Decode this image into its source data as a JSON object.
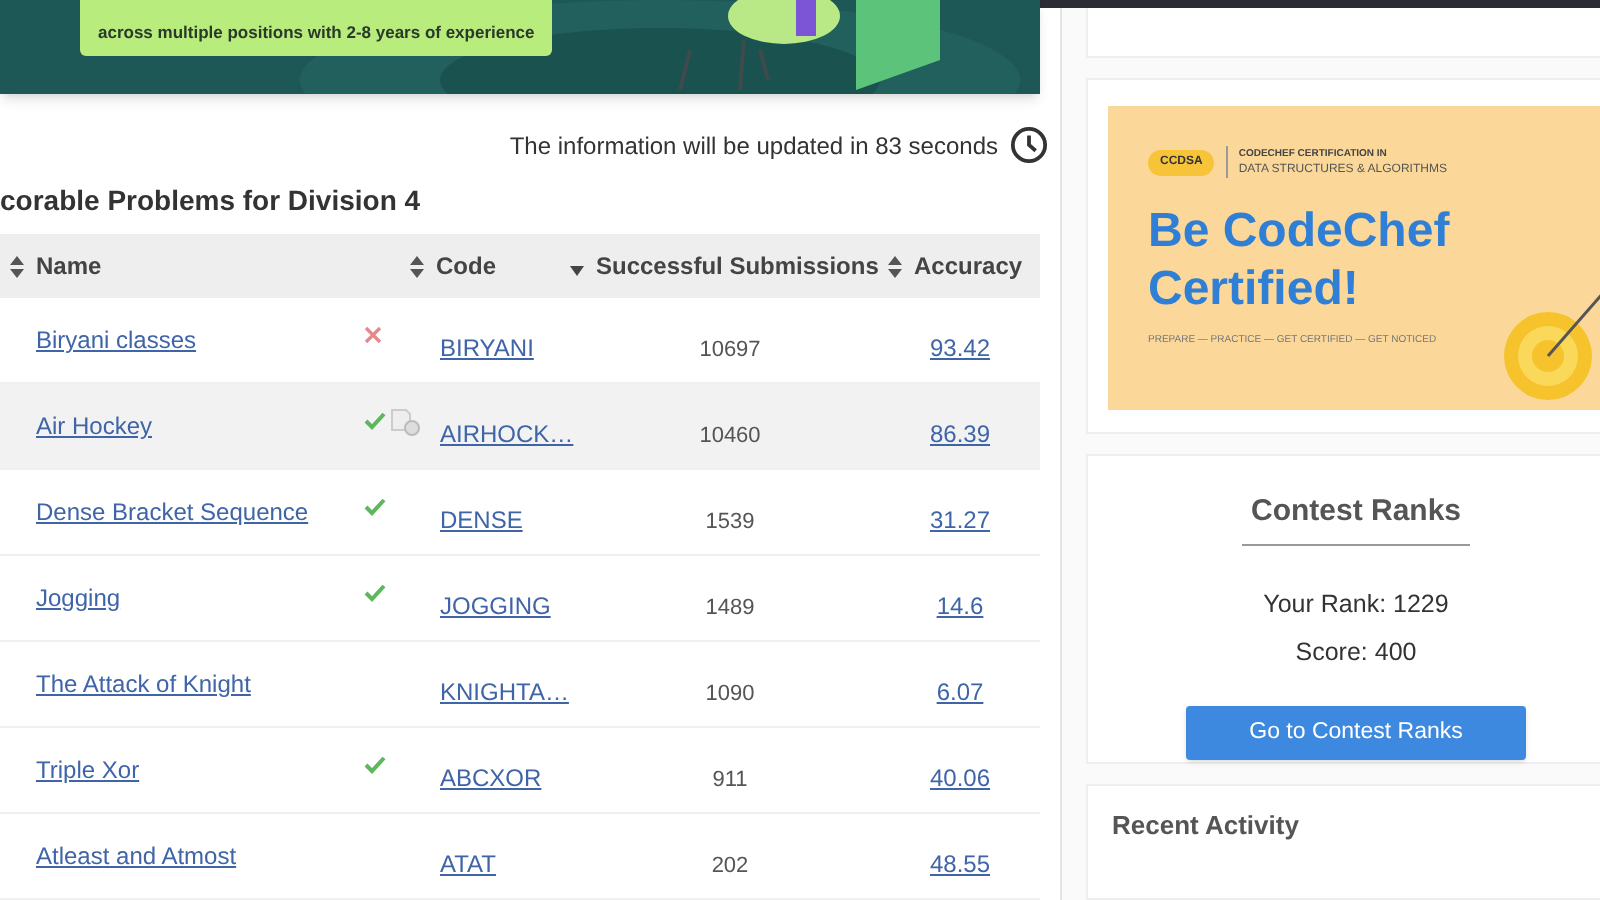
{
  "promo_banner": {
    "text": "across multiple positions with 2-8 years of experience"
  },
  "update_notice": "The information will be updated in 83 seconds",
  "problems": {
    "title": "corable Problems for Division 4",
    "columns": [
      {
        "label": "Name",
        "sorted_descending": false
      },
      {
        "label": "Code",
        "sorted_descending": false
      },
      {
        "label": "Successful Submissions",
        "sorted_descending": true
      },
      {
        "label": "Accuracy",
        "sorted_descending": false
      }
    ],
    "rows": [
      {
        "name": "Biryani classes",
        "accepted": false,
        "wrong": true,
        "editorial": false,
        "highlighted": false,
        "code": "BIRYANI",
        "submissions": "10697",
        "accuracy": "93.42"
      },
      {
        "name": "Air Hockey",
        "accepted": true,
        "wrong": false,
        "editorial": true,
        "highlighted": true,
        "code": "AIRHOCK…",
        "submissions": "10460",
        "accuracy": "86.39"
      },
      {
        "name": "Dense Bracket Sequence",
        "accepted": true,
        "wrong": false,
        "editorial": false,
        "highlighted": false,
        "code": "DENSE",
        "submissions": "1539",
        "accuracy": "31.27"
      },
      {
        "name": "Jogging",
        "accepted": true,
        "wrong": false,
        "editorial": false,
        "highlighted": false,
        "code": "JOGGING",
        "submissions": "1489",
        "accuracy": "14.6"
      },
      {
        "name": "The Attack of Knight",
        "accepted": false,
        "wrong": false,
        "editorial": false,
        "highlighted": false,
        "code": "KNIGHTA…",
        "submissions": "1090",
        "accuracy": "6.07"
      },
      {
        "name": "Triple Xor",
        "accepted": true,
        "wrong": false,
        "editorial": false,
        "highlighted": false,
        "code": "ABCXOR",
        "submissions": "911",
        "accuracy": "40.06"
      },
      {
        "name": "Atleast and Atmost",
        "accepted": false,
        "wrong": false,
        "editorial": false,
        "highlighted": false,
        "code": "ATAT",
        "submissions": "202",
        "accuracy": "48.55"
      }
    ]
  },
  "certification_banner": {
    "badge": "CCDSA",
    "subtitle": "CODECHEF CERTIFICATION IN",
    "program": "DATA STRUCTURES & ALGORITHMS",
    "headline": "Be CodeChef Certified!",
    "steps": "PREPARE — PRACTICE — GET CERTIFIED — GET NOTICED"
  },
  "contest_ranks": {
    "title": "Contest Ranks",
    "rank": "Your Rank: 1229",
    "score": "Score: 400",
    "button": "Go to Contest Ranks"
  },
  "recent_activity": {
    "title": "Recent Activity"
  }
}
